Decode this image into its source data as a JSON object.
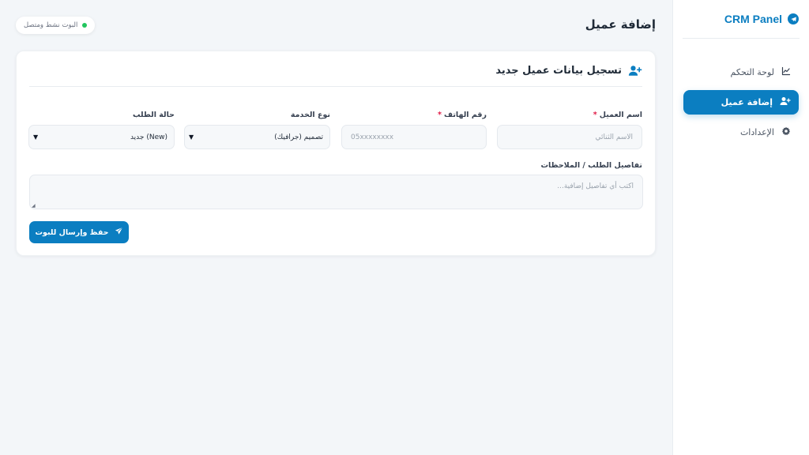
{
  "app": {
    "brand": "CRM Panel",
    "accent_color": "#0b7ec1"
  },
  "sidebar": {
    "items": [
      {
        "label": "لوحة التحكم",
        "icon": "chart-line-icon",
        "active": false
      },
      {
        "label": "إضافة عميل",
        "icon": "user-plus-icon",
        "active": true
      },
      {
        "label": "الإعدادات",
        "icon": "gear-icon",
        "active": false
      }
    ]
  },
  "header": {
    "title": "إضافة عميل",
    "status_text": "البوت نشط ومتصل",
    "status_color": "#22c55e"
  },
  "form": {
    "title": "تسجيل بيانات عميل جديد",
    "client_name": {
      "label": "اسم العميل",
      "required_mark": "*",
      "placeholder": "الاسم الثنائي",
      "value": ""
    },
    "phone": {
      "label": "رقم الهاتف",
      "required_mark": "*",
      "placeholder": "05xxxxxxxx",
      "value": ""
    },
    "service_type": {
      "label": "نوع الخدمة",
      "selected": "تصميم (جرافيك)"
    },
    "order_status": {
      "label": "حالة الطلب",
      "selected": "جديد (New)"
    },
    "details": {
      "label": "تفاصيل الطلب / الملاحظات",
      "placeholder": "اكتب أي تفاصيل إضافية...",
      "value": ""
    },
    "submit_label": "حفظ وإرسال للبوت"
  }
}
